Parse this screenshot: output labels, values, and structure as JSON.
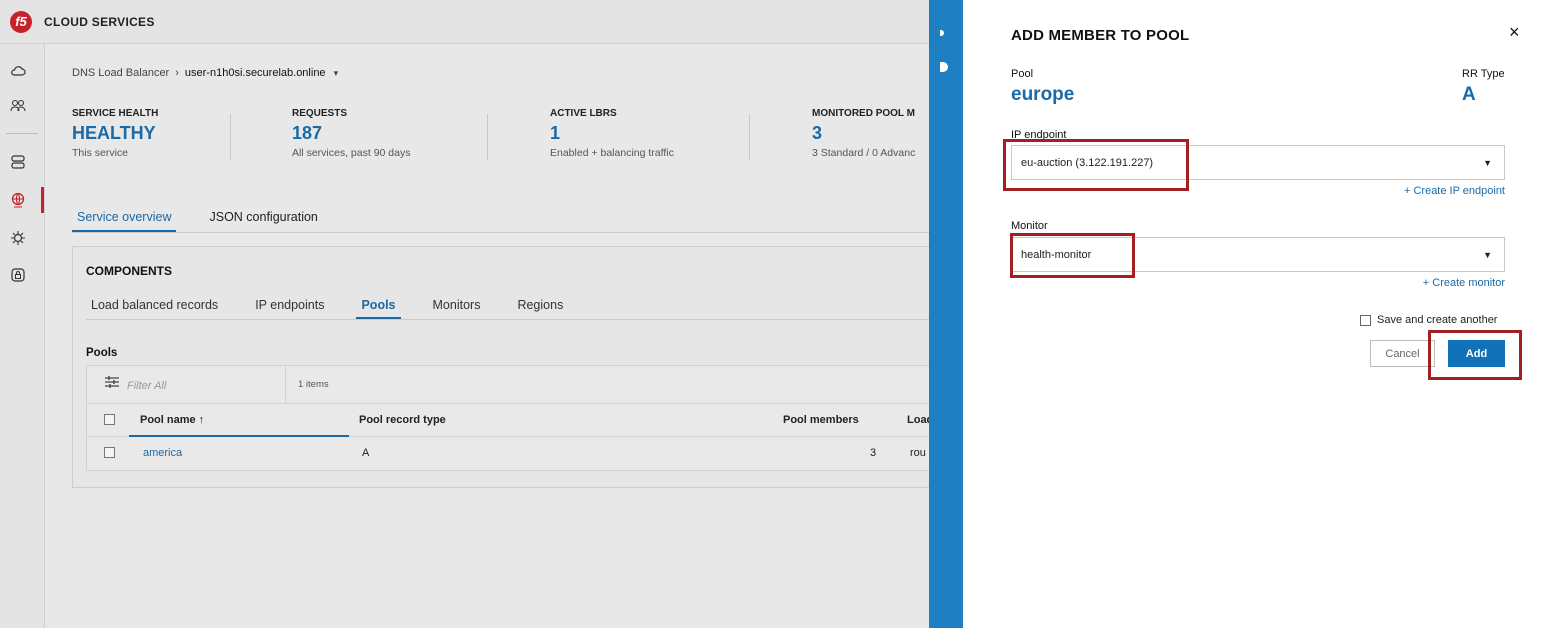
{
  "app": {
    "logo_text": "f5",
    "title": "CLOUD SERVICES"
  },
  "rail": {
    "icons": [
      "cloud-icon",
      "users-icon",
      "servers-icon",
      "globe-icon",
      "bug-icon",
      "lock-shield-icon"
    ]
  },
  "breadcrumb": {
    "parent": "DNS Load Balancer",
    "separator": "›",
    "current": "user-n1h0si.securelab.online",
    "caret": "▾"
  },
  "stats": [
    {
      "key": "SERVICE HEALTH",
      "value": "HEALTHY",
      "sub": "This service"
    },
    {
      "key": "REQUESTS",
      "value": "187",
      "sub": "All services, past 90 days"
    },
    {
      "key": "ACTIVE LBRS",
      "value": "1",
      "sub": "Enabled + balancing traffic"
    },
    {
      "key": "MONITORED POOL M",
      "value": "3",
      "sub": "3 Standard / 0 Advanc"
    }
  ],
  "tabs": {
    "overview": "Service overview",
    "json": "JSON configuration"
  },
  "components": {
    "title": "COMPONENTS",
    "subtabs": [
      "Load balanced records",
      "IP endpoints",
      "Pools",
      "Monitors",
      "Regions"
    ],
    "section": "Pools",
    "filter_placeholder": "Filter All",
    "count": "1 items",
    "columns": {
      "name": "Pool name ↑",
      "type": "Pool record type",
      "members": "Pool members",
      "lb": "Load"
    },
    "rows": [
      {
        "name": "america",
        "type": "A",
        "members": "3",
        "lb": "rou"
      }
    ]
  },
  "drawer": {
    "title": "ADD MEMBER TO POOL",
    "close": "×",
    "pool_label": "Pool",
    "pool_value": "europe",
    "rr_label": "RR Type",
    "rr_value": "A",
    "ip_label": "IP endpoint",
    "ip_value": "eu-auction (3.122.191.227)",
    "create_ip": "+ Create IP endpoint",
    "monitor_label": "Monitor",
    "monitor_value": "health-monitor",
    "create_monitor": "+ Create monitor",
    "save_another": "Save and create another",
    "cancel": "Cancel",
    "add": "Add",
    "dropdown_arrow": "▼"
  },
  "colors": {
    "accent": "#1a6aa7",
    "brand_red": "#c6222b",
    "highlight": "#a51e24",
    "strip": "#1e7fc2"
  }
}
